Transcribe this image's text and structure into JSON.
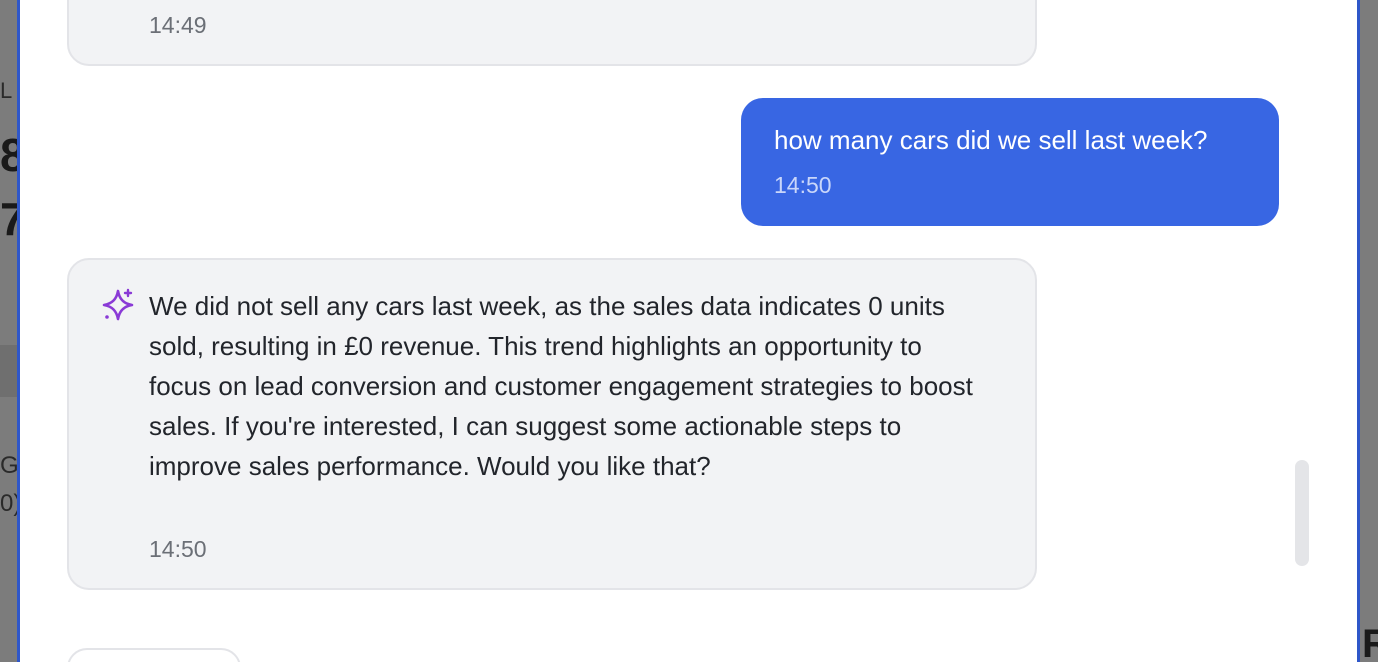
{
  "chat": {
    "messages": [
      {
        "role": "assistant",
        "text": "",
        "time": "14:49"
      },
      {
        "role": "user",
        "text": "how many cars did we sell last week?",
        "time": "14:50"
      },
      {
        "role": "assistant",
        "icon": "sparkle-icon",
        "text": "We did not sell any cars last week, as the sales data indicates 0 units sold, resulting in £0 revenue. This trend highlights an opportunity to focus on lead conversion and customer engagement strategies to boost sales. If you're interested, I can suggest some actionable steps to improve sales performance. Would you like that?",
        "time": "14:50"
      }
    ]
  },
  "colors": {
    "user_bubble": "#3866e3",
    "assistant_bubble": "#f2f3f5",
    "panel_border": "#2f57c9",
    "sparkle_icon": "#8a3ad6"
  },
  "backdrop": {
    "fragments": [
      "L",
      "8",
      "7",
      "G",
      "0)",
      "R"
    ]
  }
}
